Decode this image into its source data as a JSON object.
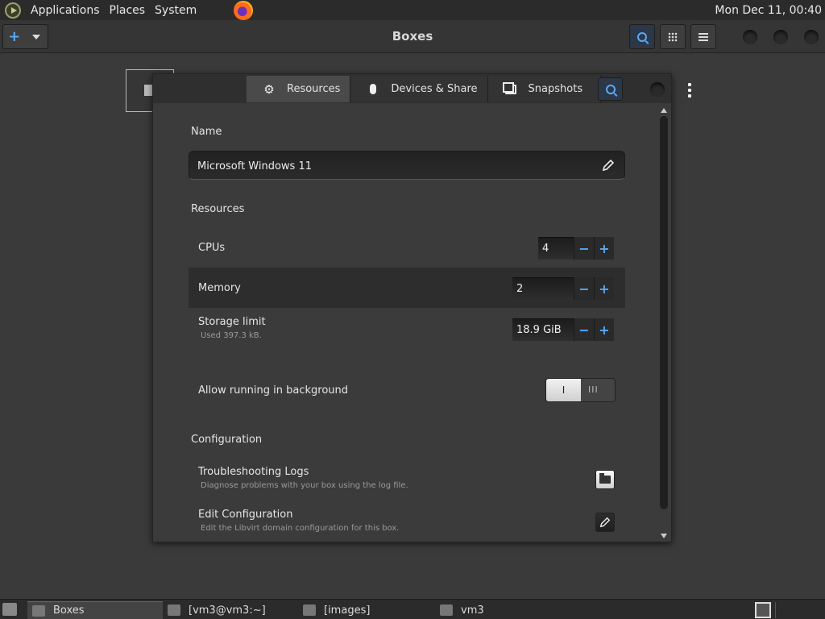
{
  "top_panel": {
    "menus": [
      "Applications",
      "Places",
      "System"
    ],
    "clock": "Mon Dec 11, 00:40"
  },
  "headerbar": {
    "title": "Boxes"
  },
  "dialog": {
    "tabs": [
      {
        "label": "Resources",
        "icon": "gear-icon",
        "active": true
      },
      {
        "label": "Devices & Share",
        "icon": "mouse-icon",
        "active": false
      },
      {
        "label": "Snapshots",
        "icon": "snapshot-icon",
        "active": false
      }
    ],
    "name_section": "Name",
    "name_value": "Microsoft Windows 11",
    "resources_section": "Resources",
    "cpus": {
      "label": "CPUs",
      "value": "4"
    },
    "memory": {
      "label": "Memory",
      "value": "2"
    },
    "storage": {
      "label": "Storage limit",
      "sub": "Used 397.3 kB.",
      "value": "18.9 GiB"
    },
    "background": {
      "label": "Allow running in background",
      "on_glyph": "I",
      "off_glyph": "III"
    },
    "configuration_section": "Configuration",
    "logs": {
      "label": "Troubleshooting Logs",
      "sub": "Diagnose problems with your box using the log file."
    },
    "edit_config": {
      "label": "Edit Configuration",
      "sub": "Edit the Libvirt domain configuration for this box."
    }
  },
  "taskbar": {
    "tasks": [
      "Boxes",
      "[vm3@vm3:~]",
      "[images]",
      "vm3"
    ]
  },
  "colors": {
    "accent": "#5aa9f2",
    "panel": "#2b2b2b",
    "dialog": "#3b3b3b"
  }
}
